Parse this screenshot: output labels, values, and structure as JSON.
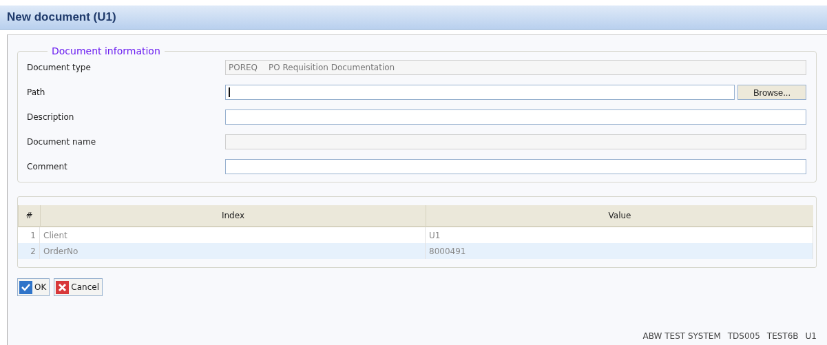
{
  "window": {
    "title": "New document (U1)"
  },
  "document_information": {
    "legend": "Document information",
    "fields": [
      {
        "label": "Document type",
        "kind": "text",
        "disabled": true,
        "code": "POREQ",
        "value": "PO Requisition Documentation"
      },
      {
        "label": "Path",
        "kind": "browse",
        "disabled": false,
        "focused": true,
        "button": "Browse..."
      },
      {
        "label": "Description",
        "kind": "text",
        "disabled": false
      },
      {
        "label": "Document name",
        "kind": "text",
        "disabled": true
      },
      {
        "label": "Comment",
        "kind": "text",
        "disabled": false
      }
    ]
  },
  "table": {
    "columns": [
      "#",
      "Index",
      "Value"
    ],
    "rows": [
      {
        "number": "1",
        "index": "Client",
        "value": "U1",
        "selected": false
      },
      {
        "number": "2",
        "index": "OrderNo",
        "value": "8000491",
        "selected": true
      }
    ]
  },
  "buttons": [
    {
      "label": "OK",
      "kind": "ok"
    },
    {
      "label": "Cancel",
      "kind": "cancel"
    }
  ],
  "status_bar": [
    "ABW TEST SYSTEM",
    "TDS005",
    "TEST6B",
    "U1"
  ]
}
